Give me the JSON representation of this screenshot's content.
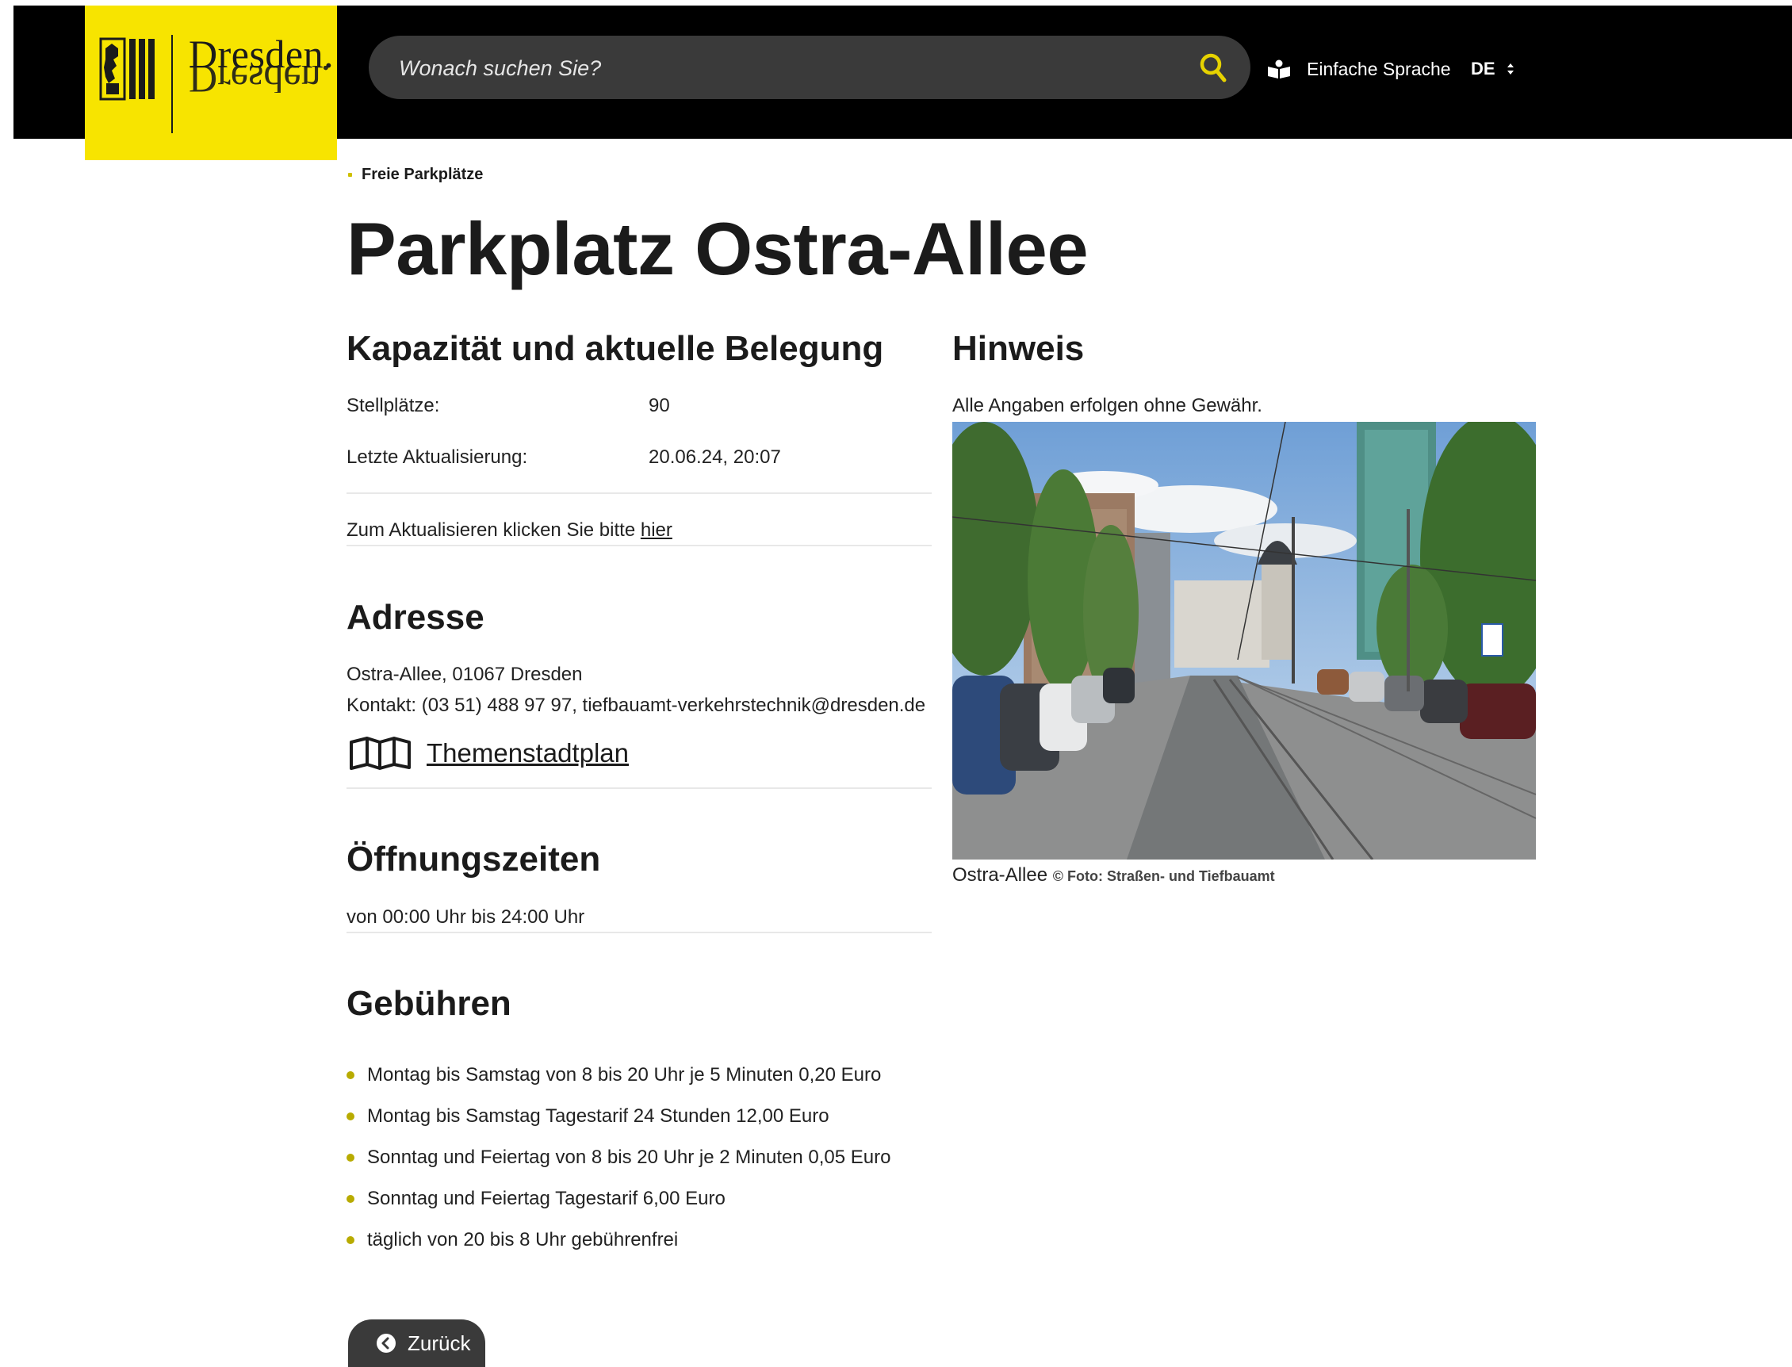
{
  "header": {
    "logo_text": "Dresden.",
    "search": {
      "placeholder": "Wonach suchen Sie?"
    },
    "easy_language_label": "Einfache Sprache",
    "language_label": "DE"
  },
  "breadcrumb": {
    "item": "Freie Parkplätze"
  },
  "page": {
    "title": "Parkplatz Ostra-Allee"
  },
  "capacity": {
    "heading": "Kapazität und aktuelle Belegung",
    "spaces_label": "Stellplätze:",
    "spaces_value": "90",
    "updated_label": "Letzte Aktualisierung:",
    "updated_value": "20.06.24, 20:07",
    "refresh_text": "Zum Aktualisieren klicken Sie bitte",
    "refresh_link": "hier"
  },
  "address": {
    "heading": "Adresse",
    "line1": "Ostra-Allee, 01067 Dresden",
    "contact": "Kontakt: (03 51) 488 97 97, tiefbauamt-verkehrstechnik@dresden.de",
    "map_link": "Themenstadtplan"
  },
  "hours": {
    "heading": "Öffnungszeiten",
    "text": "von 00:00 Uhr bis 24:00 Uhr"
  },
  "fees": {
    "heading": "Gebühren",
    "items": [
      "Montag bis Samstag von 8 bis 20 Uhr je 5 Minuten 0,20 Euro",
      "Montag bis Samstag Tagestarif 24 Stunden 12,00 Euro",
      "Sonntag und Feiertag von 8 bis 20 Uhr je 2 Minuten 0,05 Euro",
      "Sonntag und Feiertag Tagestarif 6,00 Euro",
      "täglich von 20 bis 8 Uhr gebührenfrei"
    ]
  },
  "notice": {
    "heading": "Hinweis",
    "text": "Alle Angaben erfolgen ohne Gewähr.",
    "caption": "Ostra-Allee",
    "credit": "© Foto: Straßen- und Tiefbauamt"
  },
  "back_button": {
    "label": "Zurück"
  },
  "colors": {
    "brand_yellow": "#f7e400",
    "header_bg": "#000000",
    "button_bg": "#3a3a3a",
    "bullet": "#b8ab00"
  }
}
